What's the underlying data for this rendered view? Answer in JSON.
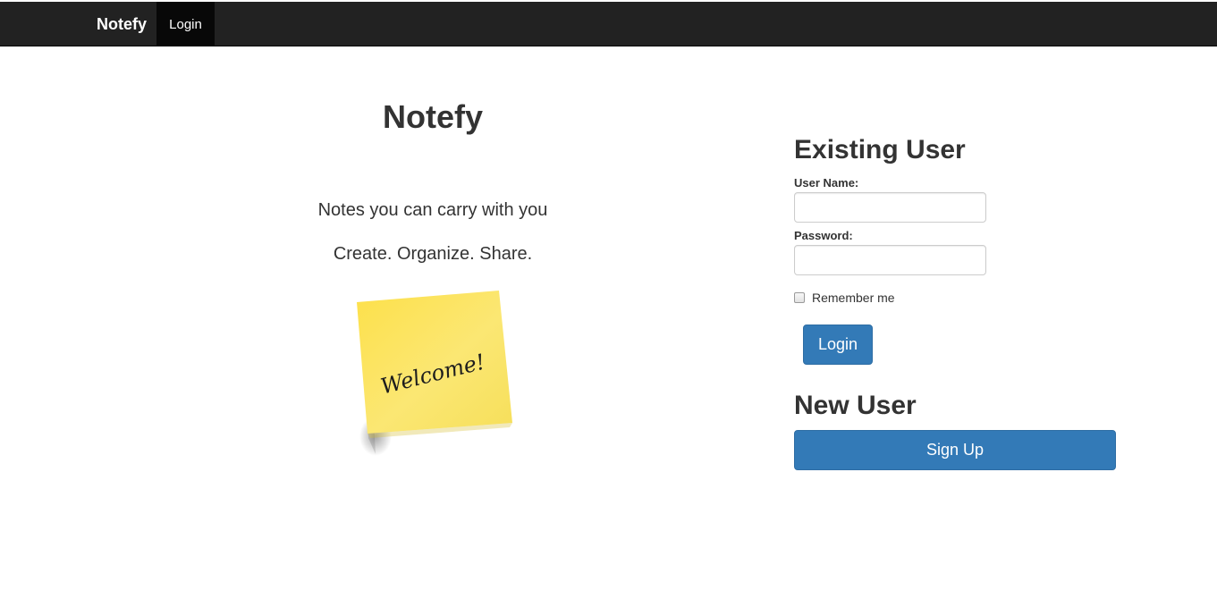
{
  "navbar": {
    "brand": "Notefy",
    "login_link": "Login",
    "background": "#222222"
  },
  "hero": {
    "title": "Notefy",
    "tagline": "Notes you can carry with you",
    "subtagline": "Create. Organize. Share.",
    "sticky_note_text": "Welcome!",
    "sticky_note_color": "#fbe26b"
  },
  "existing_user": {
    "heading": "Existing User",
    "username_label": "User Name:",
    "username_value": "",
    "password_label": "Password:",
    "password_value": "",
    "remember_label": "Remember me",
    "remember_checked": false,
    "login_button": "Login"
  },
  "new_user": {
    "heading": "New User",
    "signup_button": "Sign Up"
  },
  "colors": {
    "primary_button": "#337ab7"
  }
}
